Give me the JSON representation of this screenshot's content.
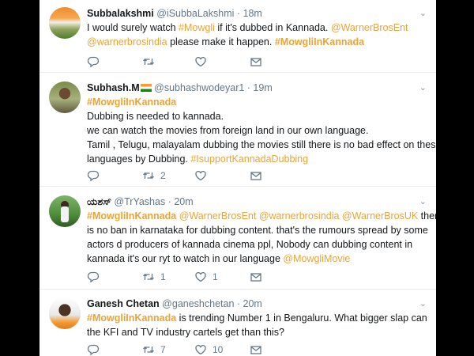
{
  "tweets": [
    {
      "name": "Subbalakshmi",
      "handle": "@iSubbaLakshmi",
      "time": "· 18m",
      "lines": [
        [
          {
            "t": "I would surely watch ",
            "s": ""
          },
          {
            "t": "#Mowgli",
            "s": "hl"
          },
          {
            "t": " if it's dubbed in Kannada. ",
            "s": ""
          },
          {
            "t": "@WarnerBrosEnt",
            "s": "hl"
          }
        ],
        [
          {
            "t": "@warnerbrosindia",
            "s": "hl"
          },
          {
            "t": " please make it happen. ",
            "s": ""
          },
          {
            "t": "#MowgliInKannada",
            "s": "hlb"
          }
        ]
      ],
      "replies": "",
      "retweets": "",
      "likes": ""
    },
    {
      "name": "Subhash.M",
      "handle": "@subhashwodeyar1",
      "time": "· 19m",
      "lines": [
        [
          {
            "t": "#MowgliInKannada",
            "s": "hlb"
          }
        ],
        [
          {
            "t": "Dubbing is needed to kannada.",
            "s": ""
          }
        ],
        [
          {
            "t": " we can watch the movies from foreign land in our own language.",
            "s": ""
          }
        ],
        [
          {
            "t": "Tamil , Telugu, malayalam dubbing the movies still there is no bad effect on these",
            "s": ""
          }
        ],
        [
          {
            "t": "languages by Dubbing. ",
            "s": ""
          },
          {
            "t": "#IsupportKannadaDubbing",
            "s": "hl"
          }
        ]
      ],
      "replies": "",
      "retweets": "2",
      "likes": ""
    },
    {
      "name": "ಯಶಸ್",
      "handle": "@TrYashas",
      "time": "· 20m",
      "lines": [
        [
          {
            "t": "#MowgliInKannada",
            "s": "hlb"
          },
          {
            "t": " ",
            "s": ""
          },
          {
            "t": "@WarnerBrosEnt @warnerbrosindia @WarnerBrosUK",
            "s": "hl"
          },
          {
            "t": " there",
            "s": ""
          }
        ],
        [
          {
            "t": "is no ban in karnataka for dubbing content. that's the rumours spread by some",
            "s": ""
          }
        ],
        [
          {
            "t": "actors d producers of kannada cinema ppl, Nobody can dubbing content in",
            "s": ""
          }
        ],
        [
          {
            "t": "kannada it's our ryt to watch in our language ",
            "s": ""
          },
          {
            "t": "@MowgliMovie",
            "s": "hl"
          }
        ]
      ],
      "replies": "",
      "retweets": "1",
      "likes": "1"
    },
    {
      "name": "Ganesh Chetan",
      "handle": "@ganeshchetan",
      "time": "· 20m",
      "lines": [
        [
          {
            "t": "#MowgliInKannada",
            "s": "hlb"
          },
          {
            "t": " is trending Number 1 in Bengaluru. What bigger slap can",
            "s": ""
          }
        ],
        [
          {
            "t": "the KFI and TV industry cartels get than this?",
            "s": ""
          }
        ]
      ],
      "replies": "",
      "retweets": "7",
      "likes": "10"
    }
  ],
  "icons": {
    "reply": "reply-icon",
    "retweet": "retweet-icon",
    "like": "heart-icon",
    "dm": "envelope-icon",
    "more": "chevron-down-icon"
  },
  "colors": {
    "highlight": "#e8a43a",
    "text": "#14171a",
    "muted": "#657786",
    "separator": "#e6ecf0"
  }
}
